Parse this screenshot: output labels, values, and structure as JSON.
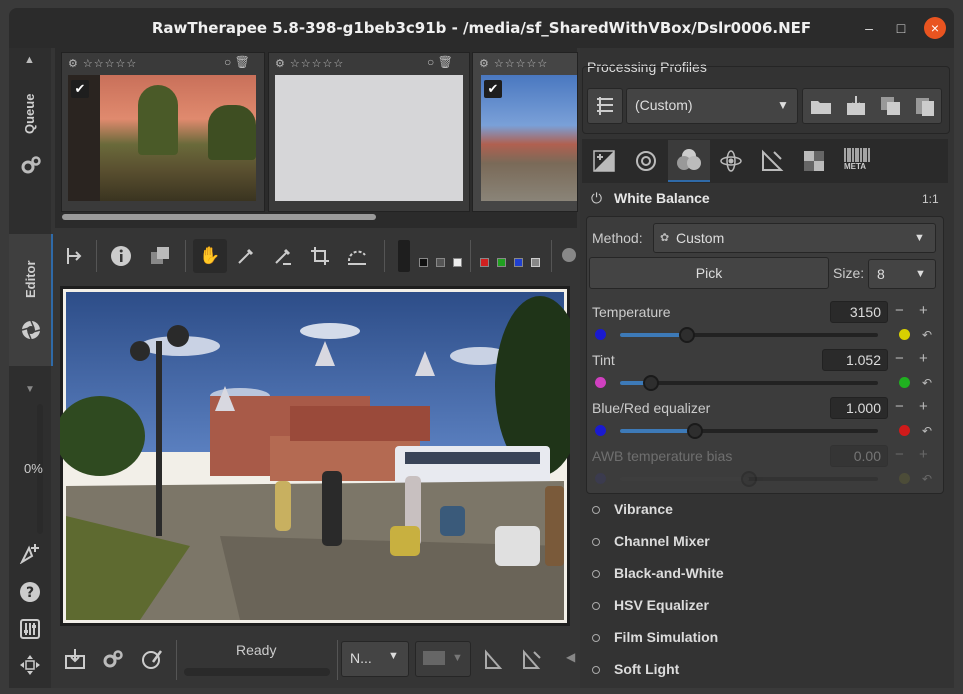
{
  "window": {
    "title": "RawTherapee 5.8-398-g1beb3c91b - /media/sf_SharedWithVBox/Dslr0006.NEF",
    "minimize": "–",
    "maximize": "□",
    "close": "×"
  },
  "left_tabs": {
    "queue_label": "Queue",
    "editor_label": "Editor",
    "progress": "0%"
  },
  "filmstrip": {
    "thumbs": [
      {
        "stars": "☆☆☆☆☆",
        "checked": true
      },
      {
        "stars": "☆☆☆☆☆",
        "checked": false
      },
      {
        "stars": "☆☆☆☆☆",
        "checked": true
      }
    ]
  },
  "bottom": {
    "status": "Ready",
    "zoom_select": "N..."
  },
  "right": {
    "profiles_title": "Processing Profiles",
    "profile_value": "(Custom)",
    "meta_label": "META",
    "white_balance": {
      "title": "White Balance",
      "ratio": "1:1",
      "method_label": "Method:",
      "method_value": "Custom",
      "pick_label": "Pick",
      "size_label": "Size:",
      "size_value": "8",
      "sliders": [
        {
          "label": "Temperature",
          "value": "3150",
          "fraction": 0.26,
          "left_color": "#1a1ad0",
          "right_color": "#d8d000"
        },
        {
          "label": "Tint",
          "value": "1.052",
          "fraction": 0.12,
          "left_color": "#d040c0",
          "right_color": "#20b020"
        },
        {
          "label": "Blue/Red equalizer",
          "value": "1.000",
          "fraction": 0.29,
          "left_color": "#1a1ad0",
          "right_color": "#d01a1a"
        },
        {
          "label": "AWB temperature bias",
          "value": "0.00",
          "fraction": 0.5,
          "left_color": "#3a3a70",
          "right_color": "#6a6a30",
          "disabled": true
        }
      ]
    },
    "tools": [
      "Vibrance",
      "Channel Mixer",
      "Black-and-White",
      "HSV Equalizer",
      "Film Simulation",
      "Soft Light"
    ]
  }
}
